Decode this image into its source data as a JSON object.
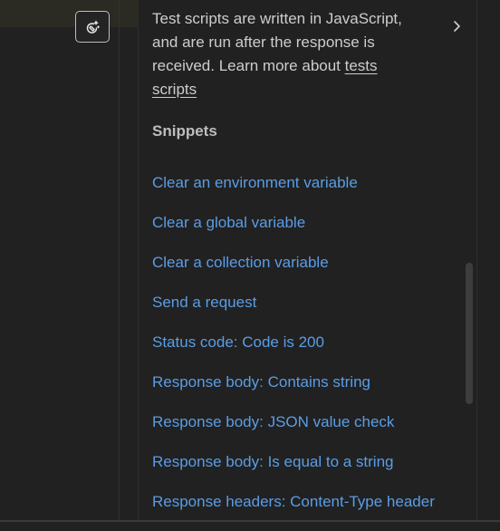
{
  "editor": {
    "ai_button_icon": "magic-wand-icon"
  },
  "tests_panel": {
    "description_prefix": "Test scripts are written in JavaScript, and are run after the response is received. Learn more about ",
    "learn_more_link": "tests scripts",
    "expand_icon": "chevron-right-icon",
    "snippets_heading": "Snippets",
    "snippets": [
      "Clear an environment variable",
      "Clear a global variable",
      "Clear a collection variable",
      "Send a request",
      "Status code: Code is 200",
      "Response body: Contains string",
      "Response body: JSON value check",
      "Response body: Is equal to a string",
      "Response headers: Content-Type header"
    ]
  },
  "colors": {
    "background": "#212121",
    "link": "#5a9de6",
    "text": "#cdcdcd",
    "heading": "#bdbdbd"
  }
}
